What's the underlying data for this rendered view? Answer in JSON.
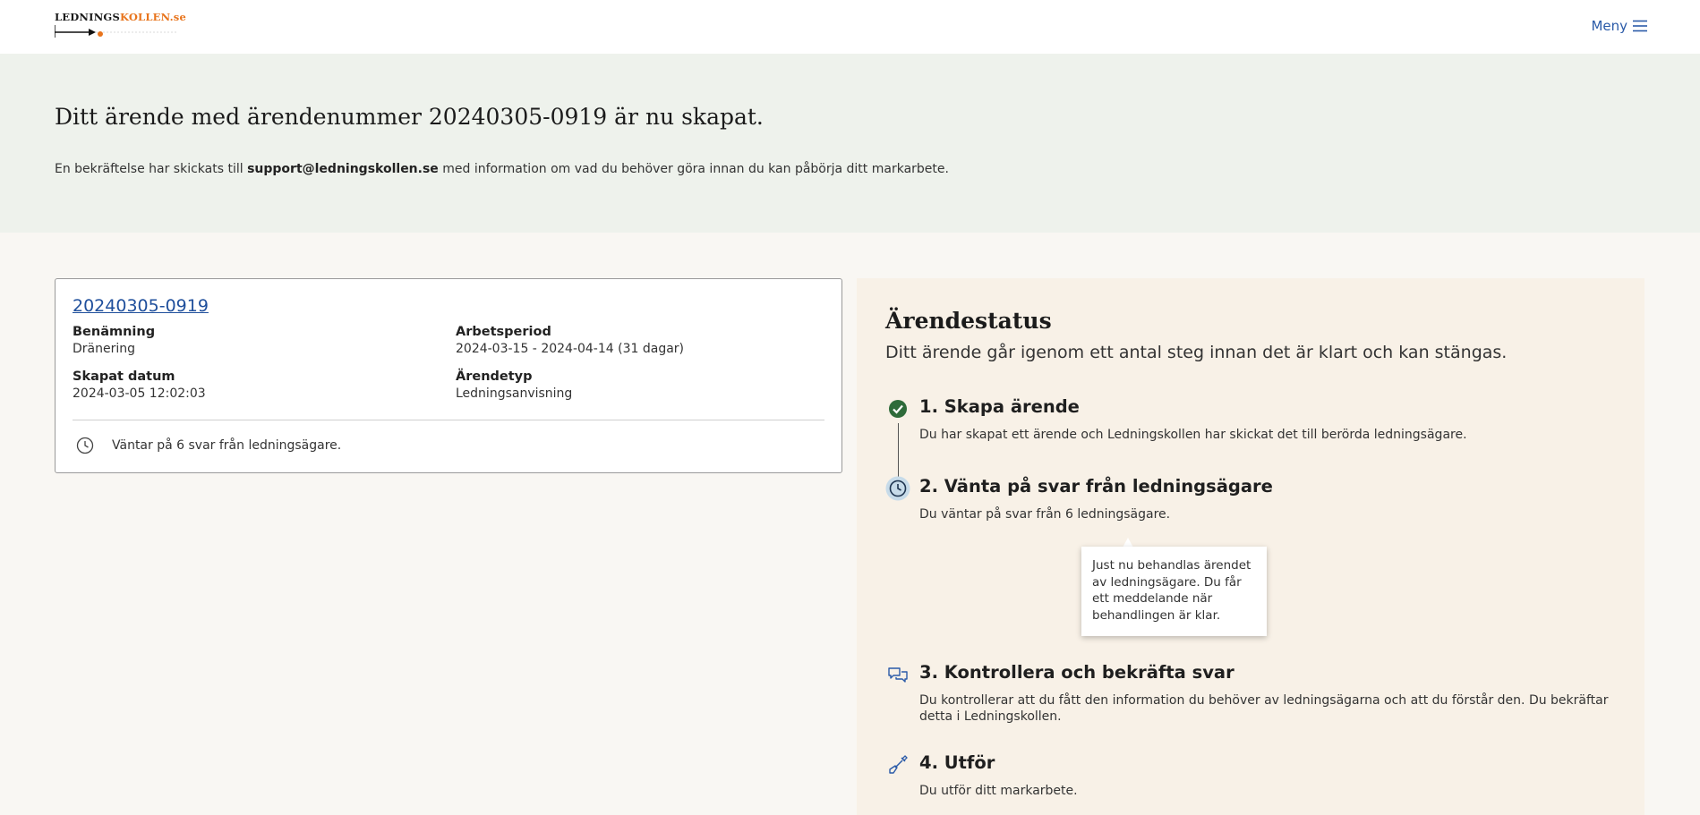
{
  "header": {
    "logo": {
      "part1": "LEDNINGS",
      "part2": "KOLLEN.se"
    },
    "menu_label": "Meny"
  },
  "hero": {
    "title": "Ditt ärende med ärendenummer 20240305-0919 är nu skapat.",
    "text_before": "En bekräftelse har skickats till ",
    "email": "support@ledningskollen.se",
    "text_after": " med information om vad du behöver göra innan du kan påbörja ditt markarbete."
  },
  "case_card": {
    "case_number": "20240305-0919",
    "fields": [
      {
        "label": "Benämning",
        "value": "Dränering"
      },
      {
        "label": "Arbetsperiod",
        "value": "2024-03-15 - 2024-04-14 (31 dagar)"
      },
      {
        "label": "Skapat datum",
        "value": "2024-03-05 12:02:03"
      },
      {
        "label": "Ärendetyp",
        "value": "Ledningsanvisning"
      }
    ],
    "status_text": "Väntar på 6 svar från ledningsägare."
  },
  "status": {
    "title": "Ärendestatus",
    "subtitle": "Ditt ärende går igenom ett antal steg innan det är klart och kan stängas.",
    "steps": [
      {
        "title": "1. Skapa ärende",
        "desc": "Du har skapat ett ärende och Ledningskollen har skickat det till berörda ledningsägare.",
        "icon": "check-circle-icon",
        "state": "done"
      },
      {
        "title": "2. Vänta på svar från ledningsägare",
        "desc": "Du väntar på svar från 6 ledningsägare.",
        "icon": "clock-icon",
        "state": "current"
      },
      {
        "title": "3. Kontrollera och bekräfta svar",
        "desc": "Du kontrollerar att du fått den information du behöver av ledningsägarna och att du förstår den. Du bekräftar detta i Ledningskollen.",
        "icon": "chat-bubbles-icon",
        "state": "pending"
      },
      {
        "title": "4. Utför",
        "desc": "Du utför ditt markarbete.",
        "icon": "shovel-icon",
        "state": "pending"
      }
    ],
    "tooltip": "Just nu behandlas ärendet av ledningsägare. Du får ett meddelande när behandlingen är klar."
  },
  "colors": {
    "accent_link": "#1f4f9c",
    "menu": "#2a5aa8",
    "done_green": "#2e6b3a",
    "hero_bg": "#eef2ec",
    "panel_bg": "#f8f1e7"
  }
}
